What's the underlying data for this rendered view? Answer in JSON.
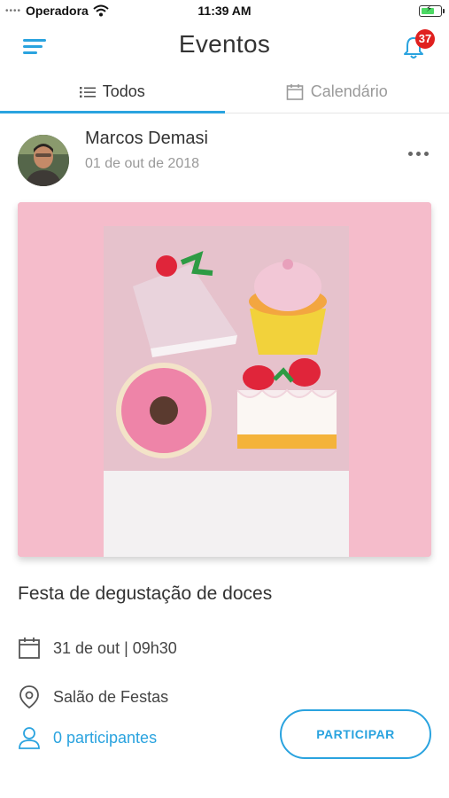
{
  "status_bar": {
    "signal": "••••",
    "carrier": "Operadora",
    "time": "11:39 AM",
    "icons": [
      "wifi-icon",
      "battery-charging-icon"
    ]
  },
  "nav": {
    "title": "Eventos",
    "menu_icon": "hamburger-menu-icon",
    "bell_icon": "bell-icon",
    "notification_count": "37"
  },
  "tabs": [
    {
      "label": "Todos",
      "icon": "list-icon",
      "active": true
    },
    {
      "label": "Calendário",
      "icon": "calendar-icon",
      "active": false
    }
  ],
  "post": {
    "author": "Marcos Demasi",
    "date": "01 de out de 2018",
    "more_icon": "more-horizontal-icon",
    "image": "photo of pastel desserts: cake slice, cupcake, donut, strawberry cake on pink background"
  },
  "event": {
    "title": "Festa de degustação de doces",
    "datetime": "31 de out | 09h30",
    "location": "Salão de Festas",
    "participants": "0 participantes",
    "participate_label": "PARTICIPAR"
  },
  "colors": {
    "accent": "#2aa3df",
    "badge": "#e0201f",
    "image_background": "#f5bccb"
  }
}
